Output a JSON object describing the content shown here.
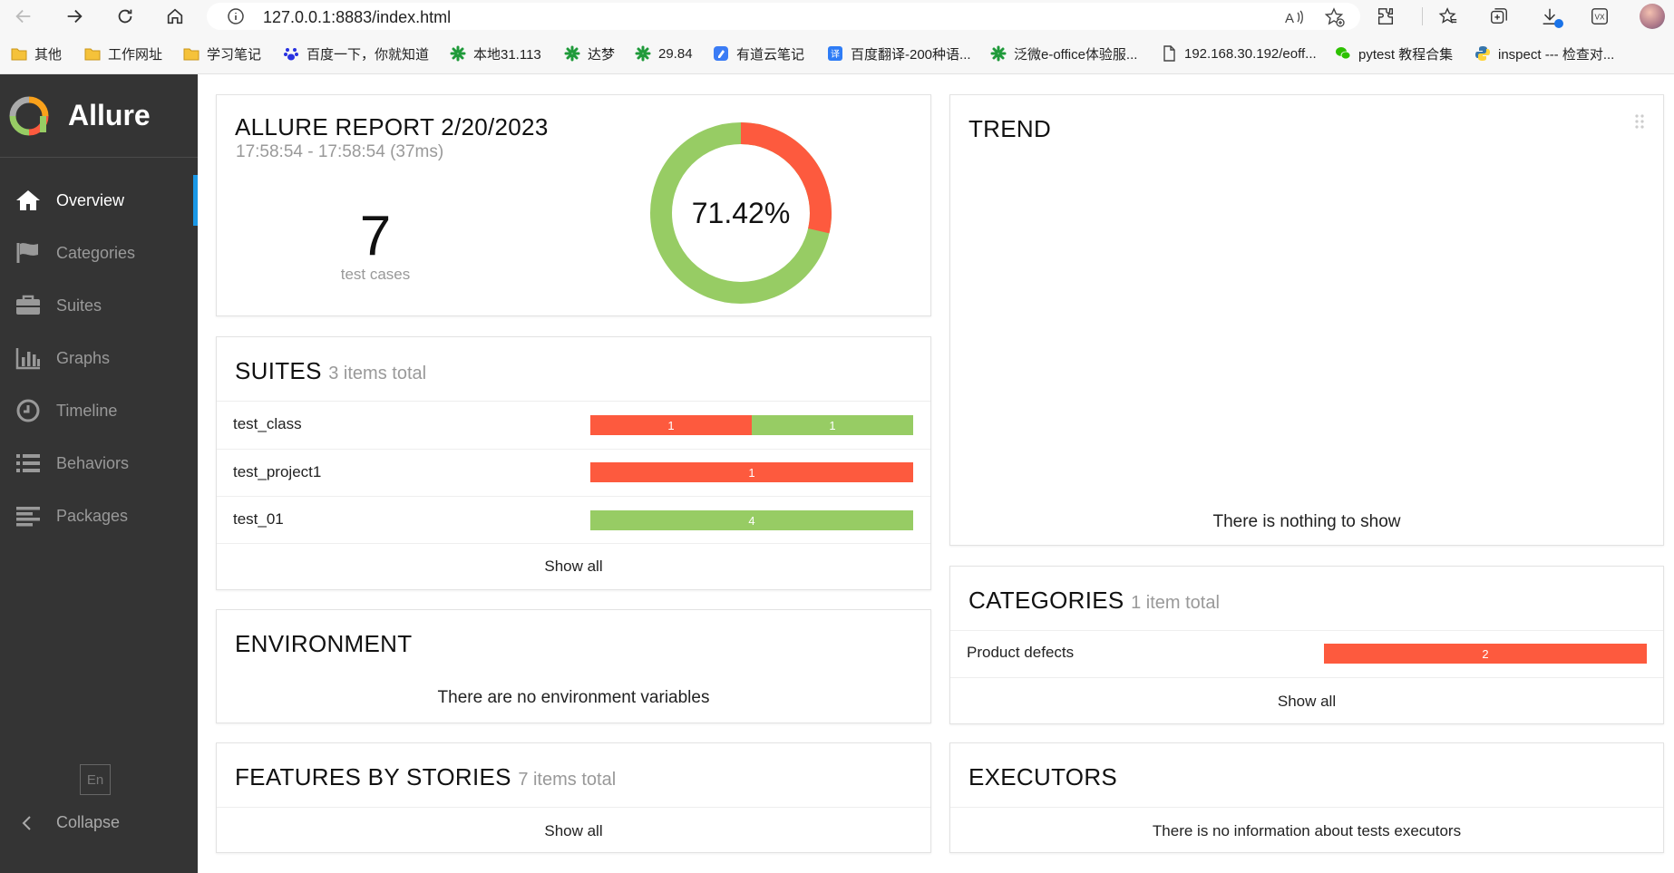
{
  "browser": {
    "url": "127.0.0.1:8883/index.html",
    "bookmarks": [
      {
        "label": "其他",
        "icon": "folder-icon"
      },
      {
        "label": "工作网址",
        "icon": "folder-icon"
      },
      {
        "label": "学习笔记",
        "icon": "folder-icon"
      },
      {
        "label": "百度一下，你就知道",
        "icon": "baidu-icon"
      },
      {
        "label": "本地31.113",
        "icon": "weaver-icon"
      },
      {
        "label": "达梦",
        "icon": "weaver-icon"
      },
      {
        "label": "29.84",
        "icon": "weaver-icon"
      },
      {
        "label": "有道云笔记",
        "icon": "youdao-note-icon"
      },
      {
        "label": "百度翻译-200种语...",
        "icon": "baidu-translate-icon"
      },
      {
        "label": "泛微e-office体验服...",
        "icon": "weaver-icon"
      },
      {
        "label": "192.168.30.192/eoff...",
        "icon": "document-icon"
      },
      {
        "label": "pytest 教程合集",
        "icon": "wechat-icon"
      },
      {
        "label": "inspect --- 检查对...",
        "icon": "python-icon"
      }
    ]
  },
  "sidebar": {
    "brand": "Allure",
    "items": [
      {
        "label": "Overview",
        "icon": "home-icon"
      },
      {
        "label": "Categories",
        "icon": "flag-icon"
      },
      {
        "label": "Suites",
        "icon": "briefcase-icon"
      },
      {
        "label": "Graphs",
        "icon": "bar-chart-icon"
      },
      {
        "label": "Timeline",
        "icon": "clock-icon"
      },
      {
        "label": "Behaviors",
        "icon": "list-icon"
      },
      {
        "label": "Packages",
        "icon": "align-left-icon"
      }
    ],
    "language": "En",
    "collapse": "Collapse"
  },
  "summary": {
    "title": "ALLURE REPORT 2/20/2023",
    "time": "17:58:54 - 17:58:54 (37ms)",
    "count": "7",
    "count_label": "test cases",
    "percent": "71.42%",
    "passed_fraction": 0.7142,
    "failed_fraction": 0.2858
  },
  "trend": {
    "title": "TREND",
    "empty": "There is nothing to show"
  },
  "suites": {
    "title": "SUITES",
    "subtitle": "3 items total",
    "rows": [
      {
        "name": "test_class",
        "failed": 1,
        "passed": 1,
        "failed_label": "1",
        "passed_label": "1"
      },
      {
        "name": "test_project1",
        "failed": 1,
        "passed": 0,
        "failed_label": "1",
        "passed_label": ""
      },
      {
        "name": "test_01",
        "failed": 0,
        "passed": 4,
        "failed_label": "",
        "passed_label": "4"
      }
    ],
    "show_all": "Show all"
  },
  "categories": {
    "title": "CATEGORIES",
    "subtitle": "1 item total",
    "rows": [
      {
        "name": "Product defects",
        "value": "2"
      }
    ],
    "show_all": "Show all"
  },
  "environment": {
    "title": "ENVIRONMENT",
    "empty": "There are no environment variables"
  },
  "features": {
    "title": "FEATURES BY STORIES",
    "subtitle": "7 items total",
    "show_all": "Show all"
  },
  "executors": {
    "title": "EXECUTORS",
    "empty": "There is no information about tests executors"
  },
  "colors": {
    "failed": "#fd5a3e",
    "passed": "#97cc64",
    "active_accent": "#1a98e6",
    "sidebar_bg": "#343434"
  }
}
